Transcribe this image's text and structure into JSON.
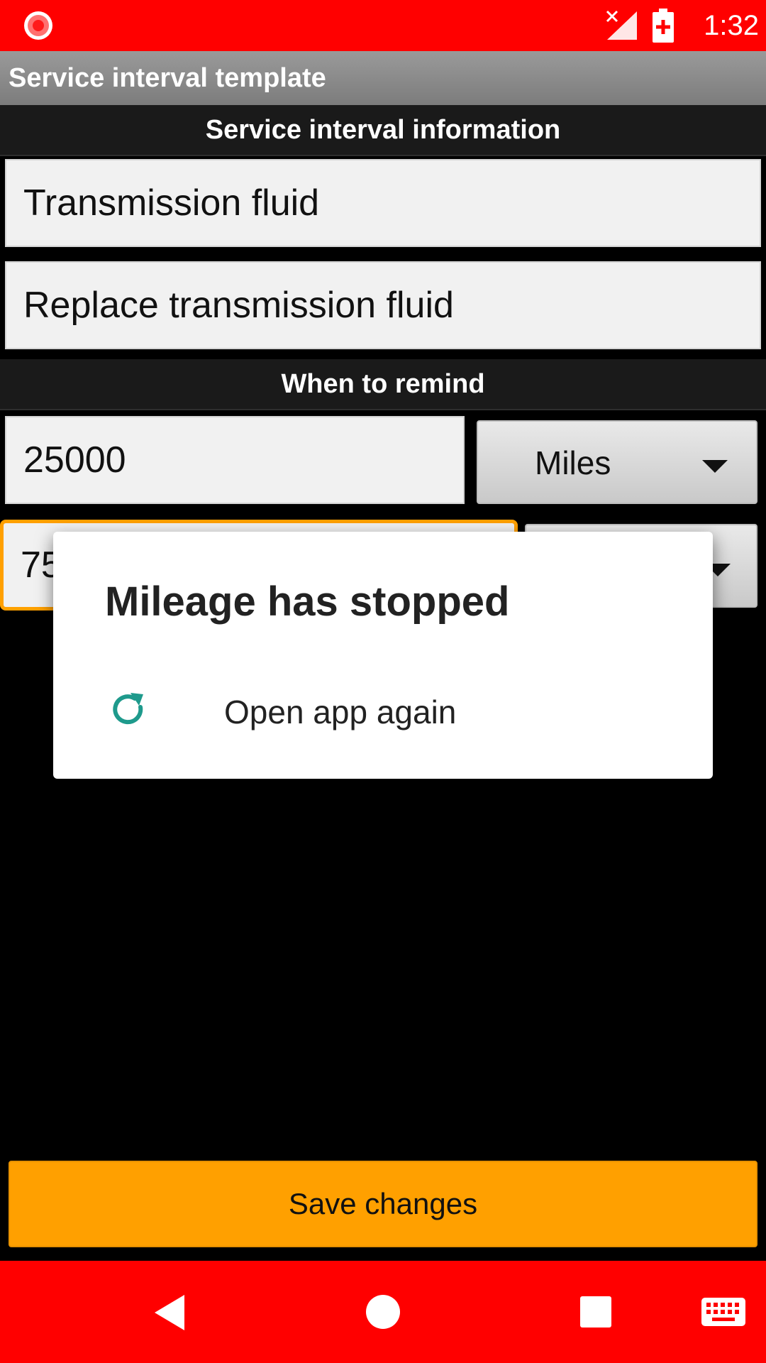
{
  "status_bar": {
    "time": "1:32",
    "icons": [
      "record-icon",
      "no-signal-icon",
      "battery-charging-icon"
    ]
  },
  "app": {
    "title": "Service interval template"
  },
  "info_section": {
    "header": "Service interval information",
    "name_value": "Transmission fluid",
    "description_value": "Replace transmission fluid"
  },
  "remind_section": {
    "header": "When to remind",
    "distance_value": "25000",
    "distance_unit": "Miles",
    "time_value_visible": "75"
  },
  "dialog": {
    "title": "Mileage has stopped",
    "action_label": "Open app again",
    "action_icon": "reload-icon"
  },
  "save_button": {
    "label": "Save changes"
  },
  "nav_bar": {
    "icons": [
      "back-icon",
      "home-icon",
      "recents-icon",
      "keyboard-icon"
    ]
  },
  "colors": {
    "status_bar": "#ff0000",
    "accent_orange": "#ffa000",
    "dialog_icon_teal": "#1e9a8c"
  }
}
